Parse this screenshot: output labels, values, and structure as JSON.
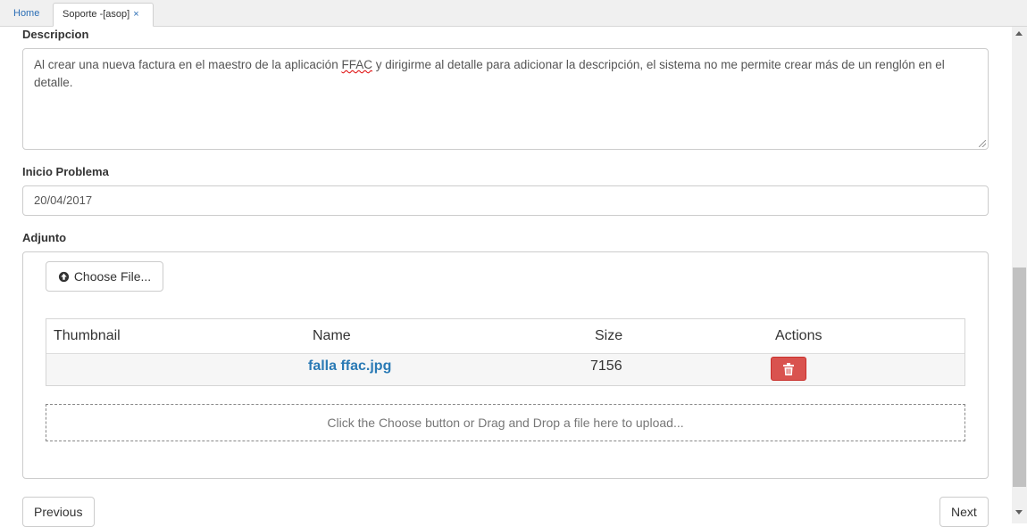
{
  "tabs": {
    "home": "Home",
    "active": "Soporte -[asop]",
    "close": "×"
  },
  "form": {
    "descripcion_label": "Descripcion",
    "descripcion_before": "Al crear una nueva factura en el maestro de la aplicación ",
    "descripcion_misspelled": "FFAC",
    "descripcion_after": " y dirigirme al detalle para adicionar la descripción, el sistema no me permite crear más de un renglón en el detalle.",
    "inicio_label": "Inicio Problema",
    "inicio_value": "20/04/2017",
    "adjunto_label": "Adjunto"
  },
  "upload": {
    "choose_label": "Choose File...",
    "columns": {
      "thumbnail": "Thumbnail",
      "name": "Name",
      "size": "Size",
      "actions": "Actions"
    },
    "files": [
      {
        "name": "falla ffac.jpg",
        "size": "7156"
      }
    ],
    "dropzone_text": "Click the Choose button or Drag and Drop a file here to upload..."
  },
  "nav": {
    "previous": "Previous",
    "next": "Next"
  },
  "colors": {
    "link": "#2a7ab5",
    "danger": "#d9534f"
  }
}
